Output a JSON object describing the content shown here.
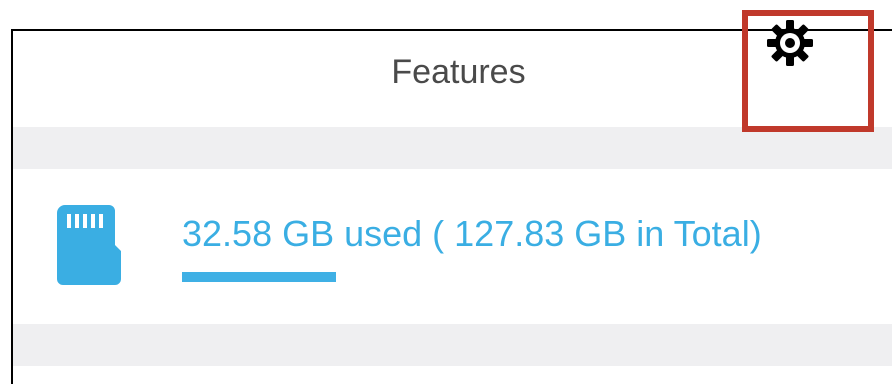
{
  "header": {
    "title": "Features",
    "settings_icon": "gear-icon"
  },
  "storage": {
    "icon": "sd-card-icon",
    "used_gb": 32.58,
    "total_gb": 127.83,
    "label": "32.58 GB used ( 127.83 GB in Total)",
    "used_fraction": 0.255
  },
  "colors": {
    "accent": "#3aaee3",
    "highlight": "#c0392b",
    "separator": "#efeff1",
    "title_text": "#4a4a4a"
  }
}
